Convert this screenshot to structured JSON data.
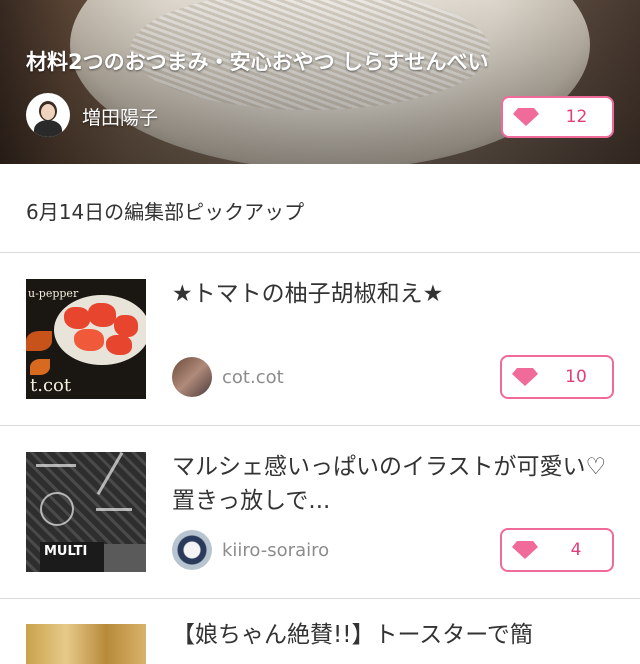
{
  "hero": {
    "title": "材料2つのおつまみ・安心おやつ しらすせんべい",
    "author": "増田陽子",
    "like_count": "12"
  },
  "section": {
    "title": "6月14日の編集部ピックアップ"
  },
  "items": [
    {
      "title": "★トマトの柚子胡椒和え★",
      "username": "cot.cot",
      "like_count": "10",
      "thumb_text": [
        "u-pepper",
        "t.cot"
      ]
    },
    {
      "title": "マルシェ感いっぱいのイラストが可愛い♡置きっ放しで...",
      "username": "kiiro-sorairo",
      "like_count": "4",
      "thumb_text": [
        "MULTI"
      ]
    },
    {
      "title": "【娘ちゃん絶賛!!】トースターで簡"
    }
  ],
  "icons": {
    "like": "heart-gem-icon"
  },
  "colors": {
    "accent": "#f06a9a",
    "count": "#e0407a",
    "divider": "#dcdcdc"
  }
}
